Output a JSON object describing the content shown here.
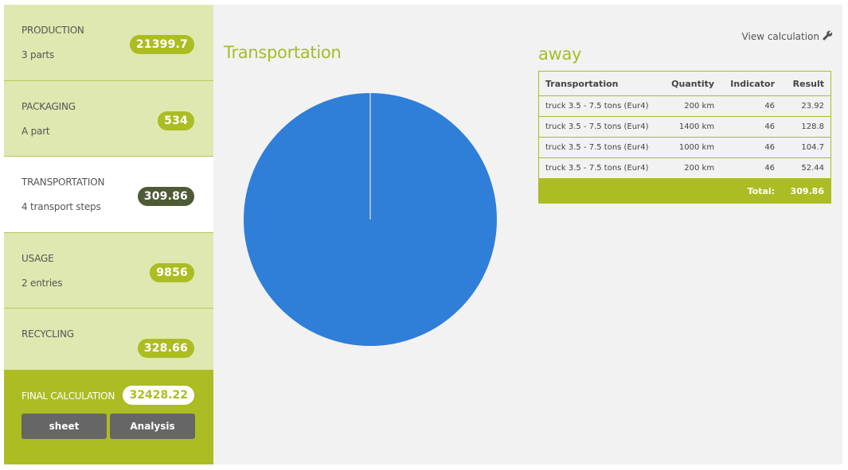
{
  "sidebar": {
    "cards": [
      {
        "title": "PRODUCTION",
        "sub": "3 parts",
        "value": "21399.7"
      },
      {
        "title": "PACKAGING",
        "sub": "A part",
        "value": "534"
      },
      {
        "title": "TRANSPORTATION",
        "sub": "4 transport steps",
        "value": "309.86"
      },
      {
        "title": "USAGE",
        "sub": "2 entries",
        "value": "9856"
      },
      {
        "title": "RECYCLING",
        "sub": "",
        "value": "328.66"
      }
    ],
    "final": {
      "title": "FINAL CALCULATION",
      "value": "32428.22",
      "btn_sheet": "sheet",
      "btn_analysis": "Analysis"
    }
  },
  "main": {
    "heading_left": "Transportation",
    "heading_right": "away",
    "view_calc": "View calculation",
    "view_calc_icon": "wrench-icon"
  },
  "table": {
    "headers": [
      "Transportation",
      "Quantity",
      "Indicator",
      "Result"
    ],
    "rows": [
      [
        "truck 3.5 - 7.5 tons (Eur4)",
        "200 km",
        "46",
        "23.92"
      ],
      [
        "truck 3.5 - 7.5 tons (Eur4)",
        "1400 km",
        "46",
        "128.8"
      ],
      [
        "truck 3.5 - 7.5 tons (Eur4)",
        "1000 km",
        "46",
        "104.7"
      ],
      [
        "truck 3.5 - 7.5 tons (Eur4)",
        "200 km",
        "46",
        "52.44"
      ]
    ],
    "total_label": "Total:",
    "total_value": "309.86"
  },
  "chart_data": {
    "type": "pie",
    "slices": [
      {
        "value": 100,
        "color": "#2f7ed8"
      }
    ]
  }
}
